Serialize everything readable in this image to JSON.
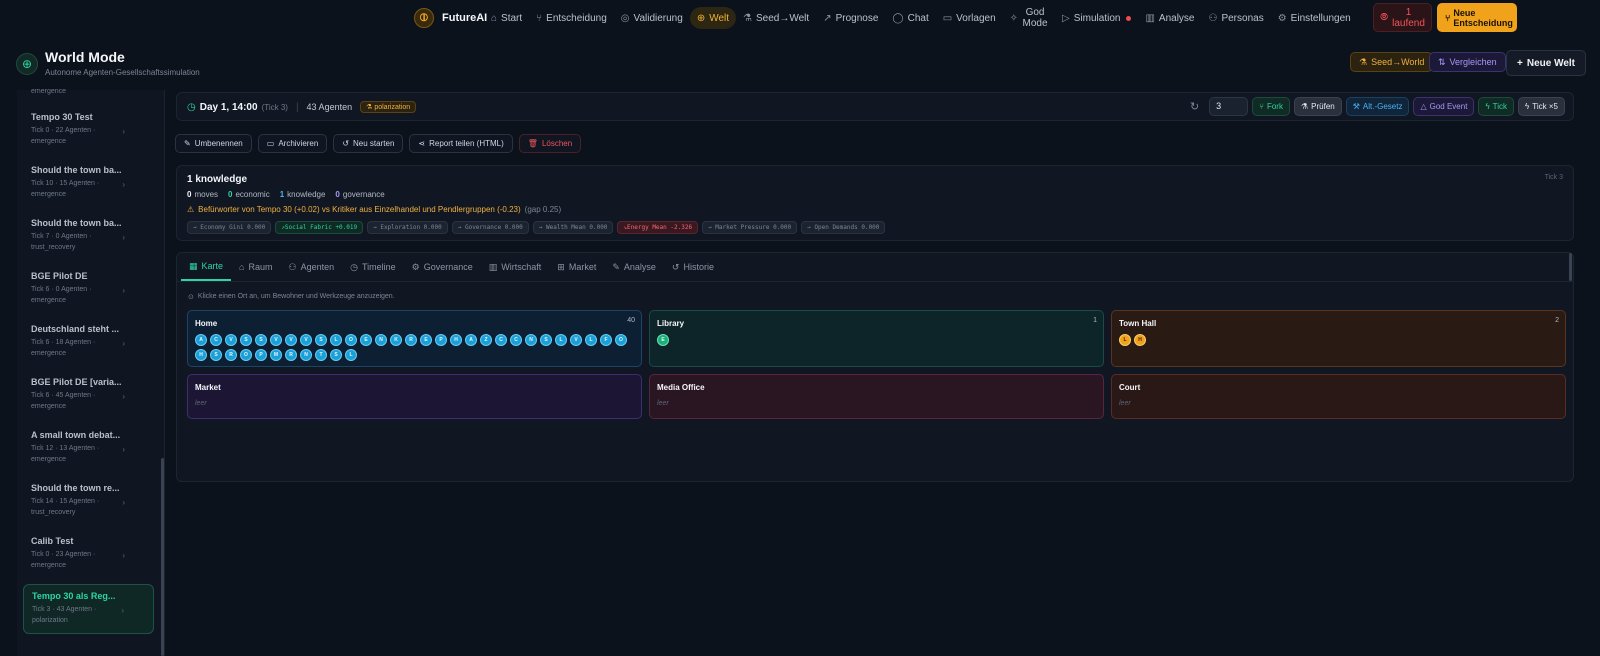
{
  "app": {
    "name": "FutureAI"
  },
  "nav": [
    {
      "label": "Start",
      "icon": "home-icon",
      "glyph": "⌂"
    },
    {
      "label": "Entscheidung",
      "icon": "branch-icon",
      "glyph": "⑂"
    },
    {
      "label": "Validierung",
      "icon": "check-circle-icon",
      "glyph": "◎"
    },
    {
      "label": "Welt",
      "icon": "globe-icon",
      "glyph": "⊕",
      "active": true
    },
    {
      "label": "Seed→Welt",
      "icon": "flask-icon",
      "glyph": "⚗"
    },
    {
      "label": "Prognose",
      "icon": "trend-icon",
      "glyph": "↗"
    },
    {
      "label": "Chat",
      "icon": "chat-icon",
      "glyph": "◯"
    },
    {
      "label": "Vorlagen",
      "icon": "template-icon",
      "glyph": "▭"
    },
    {
      "label": "God Mode",
      "icon": "sparkle-icon",
      "glyph": "✧"
    },
    {
      "label": "Simulation",
      "icon": "play-icon",
      "glyph": "▷"
    },
    {
      "label": "Analyse",
      "icon": "bar-chart-icon",
      "glyph": "▥"
    },
    {
      "label": "Personas",
      "icon": "users-icon",
      "glyph": "⚇"
    },
    {
      "label": "Einstellungen",
      "icon": "gear-icon",
      "glyph": "⚙"
    }
  ],
  "running": {
    "count": "1",
    "label": "laufend"
  },
  "new_decision": {
    "line1": "Neue",
    "line2": "Entscheidung"
  },
  "page": {
    "title": "World Mode",
    "subtitle": "Autonome Agenten-Gesellschaftssimulation"
  },
  "header_buttons": {
    "seed": "Seed→World",
    "compare": "Vergleichen",
    "new_world": "Neue Welt"
  },
  "sidebar": {
    "prev_tag": "emergence",
    "items": [
      {
        "title": "Tempo 30 Test",
        "meta": "Tick 0 · 22 Agenten ·",
        "kind": "emergence"
      },
      {
        "title": "Should the town ba...",
        "meta": "Tick 10 · 15 Agenten ·",
        "kind": "emergence"
      },
      {
        "title": "Should the town ba...",
        "meta": "Tick 7 · 0 Agenten ·",
        "kind": "trust_recovery"
      },
      {
        "title": "BGE Pilot DE",
        "meta": "Tick 6 · 0 Agenten ·",
        "kind": "emergence"
      },
      {
        "title": "Deutschland steht ...",
        "meta": "Tick 6 · 18 Agenten ·",
        "kind": "emergence"
      },
      {
        "title": "BGE Pilot DE [varia...",
        "meta": "Tick 6 · 45 Agenten ·",
        "kind": "emergence"
      },
      {
        "title": "A small town debat...",
        "meta": "Tick 12 · 13 Agenten ·",
        "kind": "emergence"
      },
      {
        "title": "Should the town re...",
        "meta": "Tick 14 · 15 Agenten ·",
        "kind": "trust_recovery"
      },
      {
        "title": "Calib Test",
        "meta": "Tick 0 · 23 Agenten ·",
        "kind": "emergence"
      },
      {
        "title": "Tempo 30 als Reg...",
        "meta": "Tick 3 · 43 Agenten ·",
        "kind": "polarization",
        "active": true
      }
    ]
  },
  "status": {
    "day": "Day 1, 14:00",
    "tick": "(Tick 3)",
    "agents": "43 Agenten",
    "badge": "polarization",
    "tick_value": "3",
    "controls": {
      "fork": "Fork",
      "pruefen": "Prüfen",
      "alt": "Alt.-Gesetz",
      "god": "God Event",
      "tick": "Tick",
      "tick5": "Tick ×5"
    }
  },
  "actions": {
    "rename": "Umbenennen",
    "archive": "Archivieren",
    "restart": "Neu starten",
    "report": "Report teilen (HTML)",
    "delete": "Löschen"
  },
  "summary": {
    "title": "1 knowledge",
    "tick": "Tick 3",
    "counts": {
      "moves": "0",
      "moves_l": "moves",
      "econ": "0",
      "econ_l": "economic",
      "know": "1",
      "know_l": "knowledge",
      "gov": "0",
      "gov_l": "governance"
    },
    "warning": "Befürworter von Tempo 30 (+0.02) vs Kritiker aus Einzelhandel und Pendlergruppen (-0.23)",
    "gap": "(gap 0.25)",
    "chips": [
      {
        "label": "→ Economy Gini 0.000",
        "tone": "neutral"
      },
      {
        "label": "↗Social Fabric +0.019",
        "tone": "pos"
      },
      {
        "label": "→ Exploration 0.000",
        "tone": "neutral"
      },
      {
        "label": "→ Governance 0.000",
        "tone": "neutral"
      },
      {
        "label": "→ Wealth Mean 0.000",
        "tone": "neutral"
      },
      {
        "label": "↘Energy Mean -2.326",
        "tone": "neg"
      },
      {
        "label": "→ Market Pressure 0.000",
        "tone": "neutral"
      },
      {
        "label": "→ Open Demands 0.000",
        "tone": "neutral"
      }
    ]
  },
  "tabs": [
    {
      "label": "Karte",
      "icon": "map-icon",
      "glyph": "▦",
      "active": true
    },
    {
      "label": "Raum",
      "icon": "room-icon",
      "glyph": "⌂"
    },
    {
      "label": "Agenten",
      "icon": "users-icon",
      "glyph": "⚇"
    },
    {
      "label": "Timeline",
      "icon": "clock-icon",
      "glyph": "◷"
    },
    {
      "label": "Governance",
      "icon": "gear-icon",
      "glyph": "⚙"
    },
    {
      "label": "Wirtschaft",
      "icon": "bar-chart-icon",
      "glyph": "▥"
    },
    {
      "label": "Market",
      "icon": "cart-icon",
      "glyph": "⊞"
    },
    {
      "label": "Analyse",
      "icon": "pen-icon",
      "glyph": "✎"
    },
    {
      "label": "Historie",
      "icon": "history-icon",
      "glyph": "↺"
    }
  ],
  "map": {
    "hint": "Klicke einen Ort an, um Bewohner und Werkzeuge anzuzeigen.",
    "empty_label": "leer",
    "locations": {
      "home": {
        "name": "Home",
        "count": "40",
        "agents": [
          "A",
          "C",
          "V",
          "S",
          "S",
          "V",
          "V",
          "V",
          "S",
          "L",
          "O",
          "E",
          "N",
          "K",
          "R",
          "E",
          "P",
          "H",
          "A",
          "Z",
          "C",
          "C",
          "N",
          "S",
          "L",
          "V",
          "L",
          "F",
          "O",
          "H",
          "S",
          "R",
          "O",
          "P",
          "M",
          "R",
          "N",
          "T",
          "S",
          "L"
        ]
      },
      "library": {
        "name": "Library",
        "count": "1",
        "agents": [
          "E"
        ]
      },
      "townhall": {
        "name": "Town Hall",
        "count": "2",
        "agents": [
          "L",
          "H"
        ]
      },
      "market": {
        "name": "Market"
      },
      "media": {
        "name": "Media Office"
      },
      "court": {
        "name": "Court"
      }
    }
  }
}
